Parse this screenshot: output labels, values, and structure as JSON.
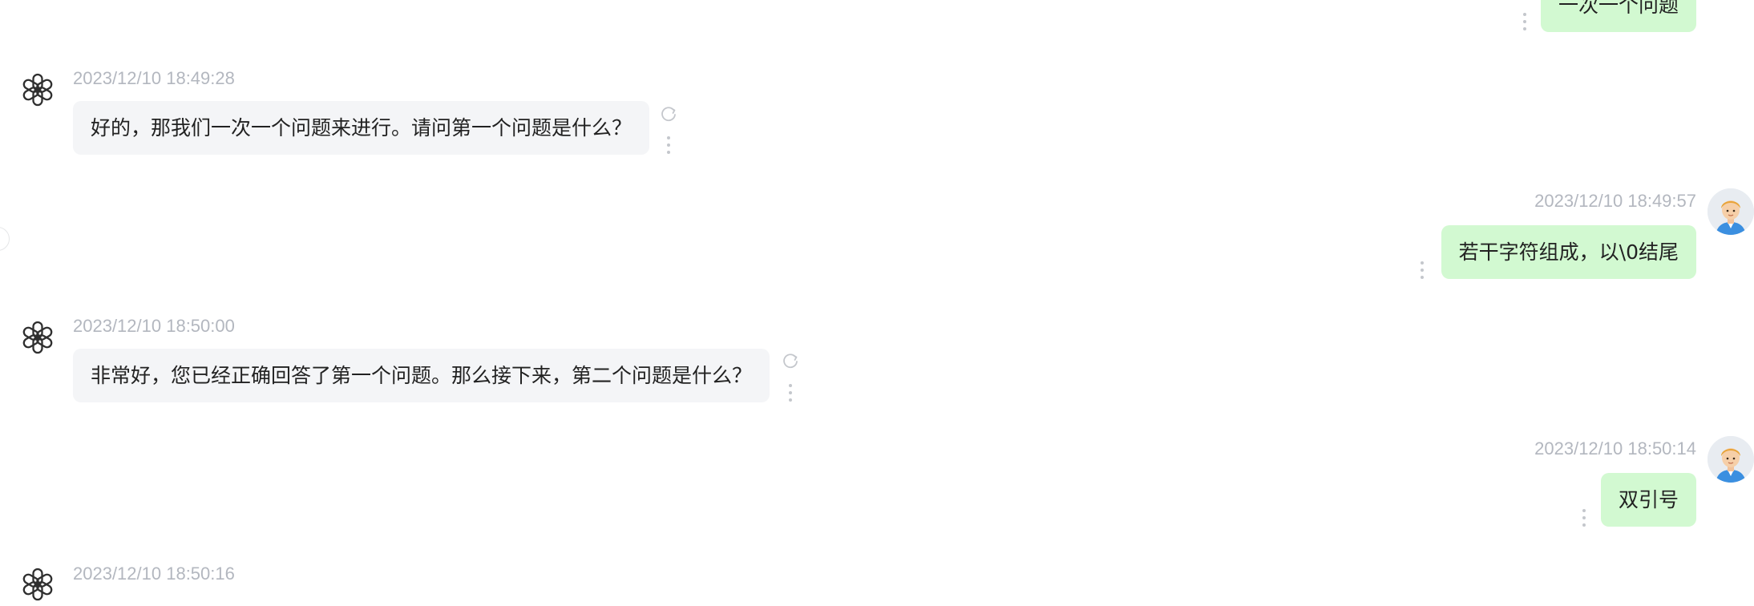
{
  "messages": [
    {
      "role": "user",
      "text": "一次一个问题"
    },
    {
      "role": "assistant",
      "timestamp": "2023/12/10 18:49:28",
      "text": "好的，那我们一次一个问题来进行。请问第一个问题是什么？"
    },
    {
      "role": "user",
      "timestamp": "2023/12/10 18:49:57",
      "text": "若干字符组成，以\\0结尾"
    },
    {
      "role": "assistant",
      "timestamp": "2023/12/10 18:50:00",
      "text": "非常好，您已经正确回答了第一个问题。那么接下来，第二个问题是什么？"
    },
    {
      "role": "user",
      "timestamp": "2023/12/10 18:50:14",
      "text": "双引号"
    },
    {
      "role": "assistant",
      "timestamp": "2023/12/10 18:50:16"
    }
  ],
  "icons": {
    "assistant_avatar": "openai-logo-icon",
    "user_avatar": "user-avatar-icon",
    "more": "kebab-menu-icon",
    "regenerate": "refresh-icon"
  },
  "colors": {
    "assistant_bubble": "#f4f5f7",
    "user_bubble": "#d2f9d1",
    "timestamp": "#b3b7bf",
    "text": "#222222"
  }
}
